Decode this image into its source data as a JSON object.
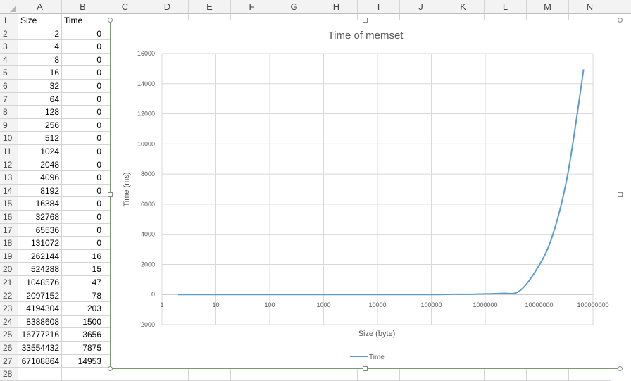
{
  "sheet": {
    "columns": [
      "A",
      "B",
      "C",
      "D",
      "E",
      "F",
      "G",
      "H",
      "I",
      "J",
      "K",
      "L",
      "M",
      "N"
    ],
    "rows": [
      "1",
      "2",
      "3",
      "4",
      "5",
      "6",
      "7",
      "8",
      "9",
      "10",
      "11",
      "12",
      "13",
      "14",
      "15",
      "16",
      "17",
      "18",
      "19",
      "20",
      "21",
      "22",
      "23",
      "24",
      "25",
      "26",
      "27",
      "28"
    ],
    "header": {
      "size": "Size",
      "time": "Time"
    },
    "data": [
      [
        "2",
        "0"
      ],
      [
        "4",
        "0"
      ],
      [
        "8",
        "0"
      ],
      [
        "16",
        "0"
      ],
      [
        "32",
        "0"
      ],
      [
        "64",
        "0"
      ],
      [
        "128",
        "0"
      ],
      [
        "256",
        "0"
      ],
      [
        "512",
        "0"
      ],
      [
        "1024",
        "0"
      ],
      [
        "2048",
        "0"
      ],
      [
        "4096",
        "0"
      ],
      [
        "8192",
        "0"
      ],
      [
        "16384",
        "0"
      ],
      [
        "32768",
        "0"
      ],
      [
        "65536",
        "0"
      ],
      [
        "131072",
        "0"
      ],
      [
        "262144",
        "16"
      ],
      [
        "524288",
        "15"
      ],
      [
        "1048576",
        "47"
      ],
      [
        "2097152",
        "78"
      ],
      [
        "4194304",
        "203"
      ],
      [
        "8388608",
        "1500"
      ],
      [
        "16777216",
        "3656"
      ],
      [
        "33554432",
        "7875"
      ],
      [
        "67108864",
        "14953"
      ]
    ]
  },
  "chart_data": {
    "type": "line",
    "title": "Time of memset",
    "xlabel": "Size (byte)",
    "ylabel": "Time (ms)",
    "x_scale": "log",
    "xlim": [
      1,
      100000000
    ],
    "ylim": [
      -2000,
      16000
    ],
    "x_ticks": [
      "1",
      "10",
      "100",
      "1000",
      "10000",
      "100000",
      "1000000",
      "10000000",
      "100000000"
    ],
    "y_ticks": [
      "-2000",
      "0",
      "2000",
      "4000",
      "6000",
      "8000",
      "10000",
      "12000",
      "14000",
      "16000"
    ],
    "grid": true,
    "legend": "bottom",
    "series": [
      {
        "name": "Time",
        "color": "#5b9bd5",
        "x": [
          2,
          4,
          8,
          16,
          32,
          64,
          128,
          256,
          512,
          1024,
          2048,
          4096,
          8192,
          16384,
          32768,
          65536,
          131072,
          262144,
          524288,
          1048576,
          2097152,
          4194304,
          8388608,
          16777216,
          33554432,
          67108864
        ],
        "y": [
          0,
          0,
          0,
          0,
          0,
          0,
          0,
          0,
          0,
          0,
          0,
          0,
          0,
          0,
          0,
          0,
          0,
          16,
          15,
          47,
          78,
          203,
          1500,
          3656,
          7875,
          14953
        ]
      }
    ]
  }
}
